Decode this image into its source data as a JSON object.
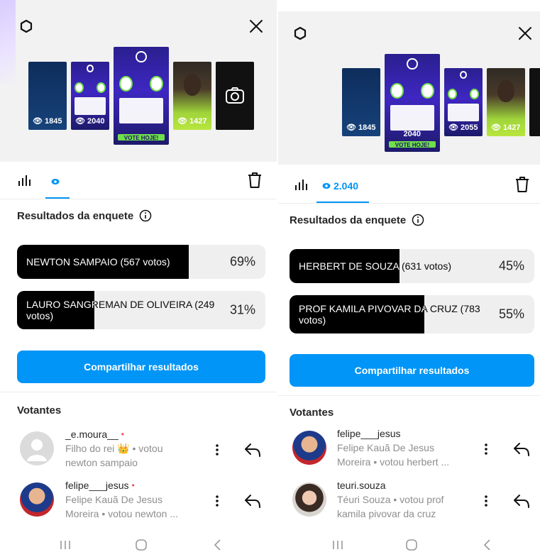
{
  "panels": [
    {
      "thumbs": [
        {
          "kind": "blue",
          "count": "1845"
        },
        {
          "kind": "poll",
          "count": "2040"
        },
        {
          "kind": "poll-active",
          "count": "",
          "vote_label": "VOTE HOJE!"
        },
        {
          "kind": "photo",
          "count": "1427"
        },
        {
          "kind": "camera",
          "count": ""
        }
      ],
      "tab_count": "",
      "results_title": "Resultados da enquete",
      "options": [
        {
          "label": "NEWTON SAMPAIO (567 votos)",
          "percent": "69%",
          "fraction": 0.69
        },
        {
          "label": "LAURO SANGREMAN DE OLIVEIRA (249 votos)",
          "percent": "31%",
          "fraction": 0.31
        }
      ],
      "share_label": "Compartilhar resultados",
      "voters_title": "Votantes",
      "voters": [
        {
          "username": "_e.moura__",
          "online": true,
          "line1": "Filho do rei 👑 • votou",
          "line2": "newton sampaio",
          "avatar": "empty"
        },
        {
          "username": "felipe___jesus",
          "online": true,
          "line1": "Felipe Kauã De Jesus",
          "line2": "Moreira • votou newton ...",
          "avatar": "photo1"
        }
      ]
    },
    {
      "thumbs": [
        {
          "kind": "blue",
          "count": "1845"
        },
        {
          "kind": "poll-active",
          "count": "2040",
          "vote_label": "VOTE HOJE!"
        },
        {
          "kind": "poll",
          "count": "2055"
        },
        {
          "kind": "photo",
          "count": "1427"
        }
      ],
      "tab_count": "2.040",
      "results_title": "Resultados da enquete",
      "options": [
        {
          "label": "HERBERT DE SOUZA (631 votos)",
          "percent": "45%",
          "fraction": 0.45
        },
        {
          "label": "PROF KAMILA PIVOVAR DA CRUZ (783 votos)",
          "percent": "55%",
          "fraction": 0.55
        }
      ],
      "share_label": "Compartilhar resultados",
      "voters_title": "Votantes",
      "voters": [
        {
          "username": "felipe___jesus",
          "online": false,
          "line1": "Felipe Kauã De Jesus",
          "line2": "Moreira • votou herbert ...",
          "avatar": "photo1"
        },
        {
          "username": "teuri.souza",
          "online": false,
          "line1": "Téuri Souza • votou prof",
          "line2": "kamila pivovar da cruz",
          "avatar": "photo2"
        }
      ]
    }
  ],
  "icons": {
    "settings": "gear-icon",
    "close": "close-icon",
    "bars": "bar-chart-icon",
    "eye": "eye-icon",
    "trash": "trash-icon",
    "info": "info-icon",
    "more": "more-vertical-icon",
    "reply": "reply-icon",
    "camera": "camera-icon",
    "nav_recent": "recent-apps-icon",
    "nav_home": "home-icon",
    "nav_back": "back-icon"
  },
  "colors": {
    "accent": "#0095f6",
    "fill": "#000000",
    "track": "#efefef",
    "online": "#ed4956"
  }
}
